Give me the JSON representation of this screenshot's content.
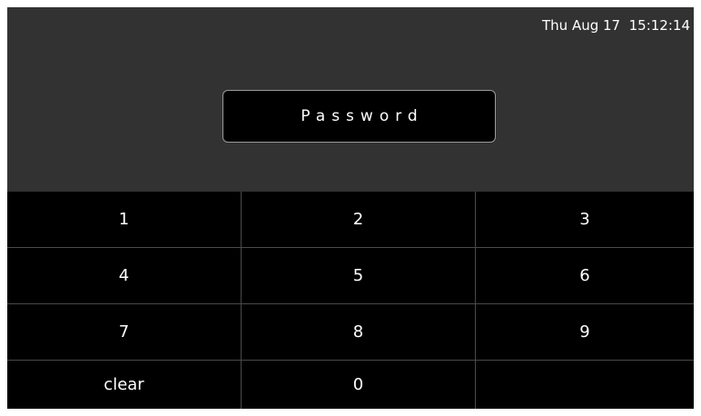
{
  "header": {
    "datetime": "Thu Aug 17  15:12:14"
  },
  "password_field": {
    "placeholder": "Password"
  },
  "keypad": {
    "keys": [
      "1",
      "2",
      "3",
      "4",
      "5",
      "6",
      "7",
      "8",
      "9",
      "clear",
      "0",
      ""
    ]
  },
  "colors": {
    "header_background": "#323232",
    "keypad_background": "#000000",
    "key_divider": "#4a4a4a",
    "text": "#ffffff",
    "field_border": "#9a9a9a"
  }
}
